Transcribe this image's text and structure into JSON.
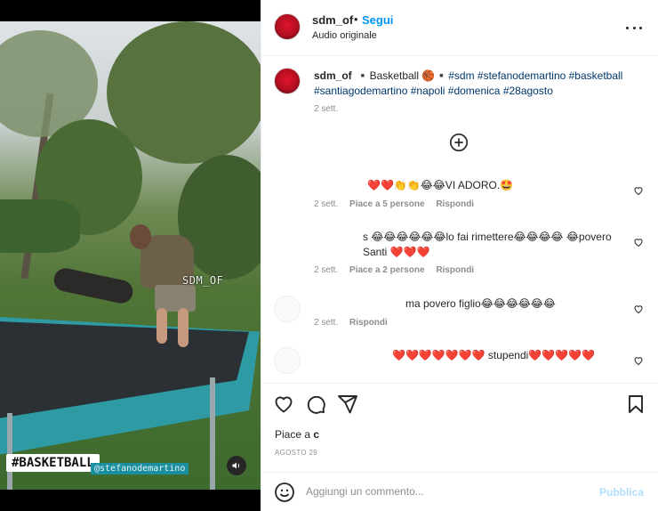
{
  "media": {
    "watermark": "SDM_OF",
    "tag": "#BASKETBALL",
    "handle": "@stefanodemartino",
    "sound_icon": "speaker-icon"
  },
  "header": {
    "username": "sdm_of",
    "dot": "•",
    "follow": "Segui",
    "audio": "Audio originale",
    "more_icon": "more-options-icon"
  },
  "caption": {
    "username": "sdm_of",
    "text_plain": "▪️Basketball 🏀▪️",
    "hashtags": "#sdm #stefanodemartino #basketball #santiagodemartino #napoli #domenica #28agosto",
    "time": "2 sett."
  },
  "load_more_icon": "plus-circle-icon",
  "comments": [
    {
      "text": "❤️❤️👏👏😂😂VI ADORO.🤩",
      "time": "2 sett.",
      "likes": "Piace a 5 persone",
      "reply": "Rispondi"
    },
    {
      "text": "s 😂😂😂😂😂😂lo fai rimettere😂😂😂😂 😂povero Santi ❤️❤️❤️",
      "time": "2 sett.",
      "likes": "Piace a 2 persone",
      "reply": "Rispondi"
    },
    {
      "text": "ma povero figlio😂😂😂😂😂😂",
      "time": "2 sett.",
      "reply": "Rispondi"
    },
    {
      "text": "❤️❤️❤️❤️❤️❤️❤️ stupendi❤️❤️❤️❤️❤️"
    }
  ],
  "actions": {
    "likes_prefix": "Piace a",
    "likes_name": "c",
    "date": "AGOSTO 29"
  },
  "add_comment": {
    "placeholder": "Aggiungi un commento...",
    "publish": "Pubblica"
  },
  "colors": {
    "accent": "#0095f6",
    "hashtag": "#00376b",
    "muted": "#8e8e8e",
    "publish_disabled": "#b2dffc"
  }
}
